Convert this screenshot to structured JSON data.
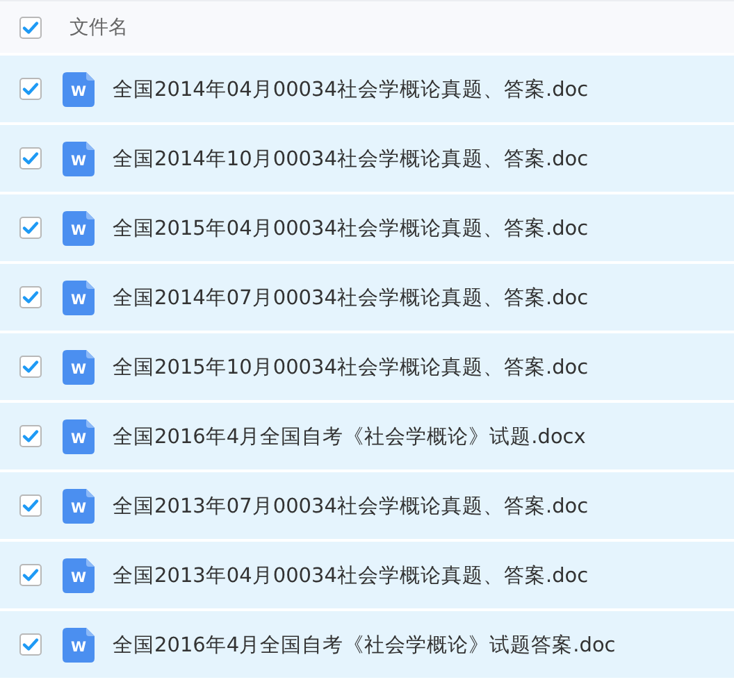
{
  "header": {
    "checked": true,
    "column_label": "文件名"
  },
  "files": [
    {
      "name": "全国2014年04月00034社会学概论真题、答案.doc",
      "icon_letter": "W",
      "checked": true,
      "selected": true
    },
    {
      "name": "全国2014年10月00034社会学概论真题、答案.doc",
      "icon_letter": "W",
      "checked": true,
      "selected": true
    },
    {
      "name": "全国2015年04月00034社会学概论真题、答案.doc",
      "icon_letter": "W",
      "checked": true,
      "selected": true
    },
    {
      "name": "全国2014年07月00034社会学概论真题、答案.doc",
      "icon_letter": "W",
      "checked": true,
      "selected": true
    },
    {
      "name": "全国2015年10月00034社会学概论真题、答案.doc",
      "icon_letter": "W",
      "checked": true,
      "selected": true
    },
    {
      "name": "全国2016年4月全国自考《社会学概论》试题.docx",
      "icon_letter": "W",
      "checked": true,
      "selected": true
    },
    {
      "name": "全国2013年07月00034社会学概论真题、答案.doc",
      "icon_letter": "W",
      "checked": true,
      "selected": true
    },
    {
      "name": "全国2013年04月00034社会学概论真题、答案.doc",
      "icon_letter": "W",
      "checked": true,
      "selected": true
    },
    {
      "name": "全国2016年4月全国自考《社会学概论》试题答案.doc",
      "icon_letter": "W",
      "checked": true,
      "selected": true
    }
  ]
}
